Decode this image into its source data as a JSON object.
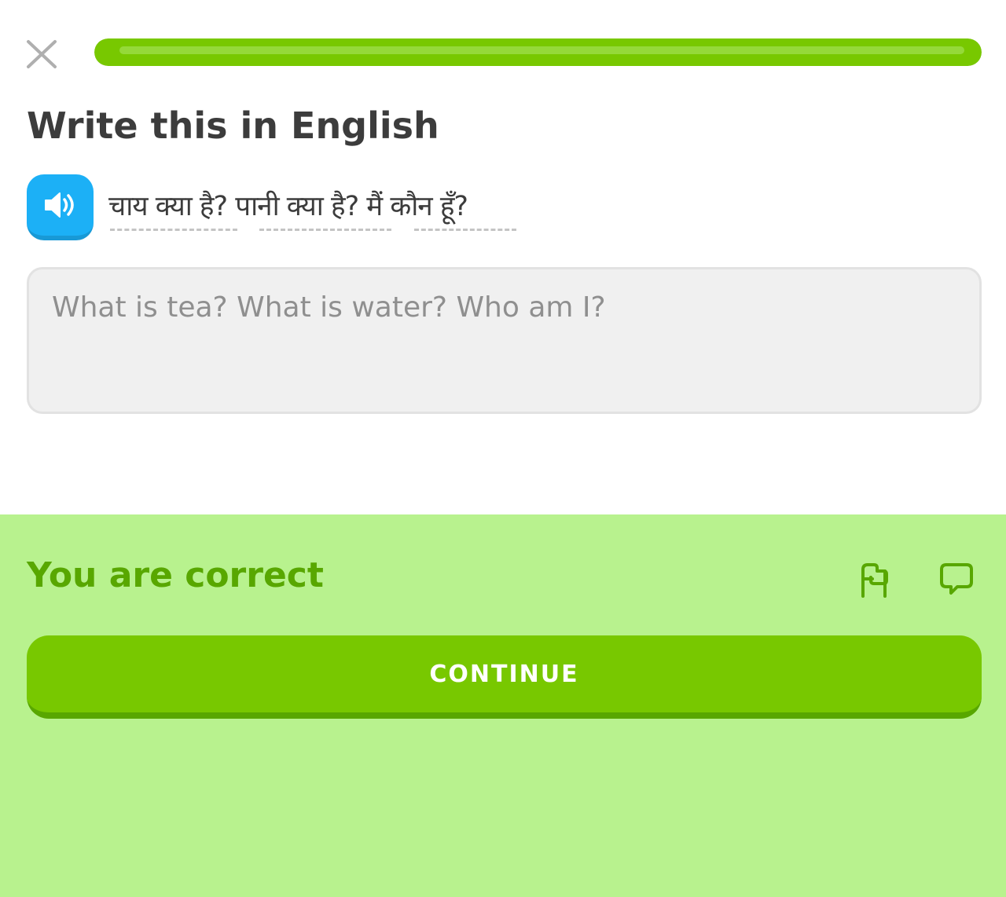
{
  "header": {
    "close_icon": "close-icon",
    "progress": 1.0
  },
  "challenge": {
    "title": "Write this in English",
    "speaker_icon": "speaker-icon",
    "prompt": "चाय क्या है? पानी क्या है? मैं कौन हूँ?"
  },
  "answer": {
    "value": "What is tea? What is water? Who am I?"
  },
  "feedback": {
    "title": "You are correct",
    "flag_icon": "flag-icon",
    "comment_icon": "comment-icon",
    "continue_label": "CONTINUE"
  },
  "colors": {
    "accent_green": "#78c800",
    "feedback_bg": "#b8f28e",
    "feedback_text": "#58a700",
    "speaker_blue": "#1cb0f6"
  }
}
